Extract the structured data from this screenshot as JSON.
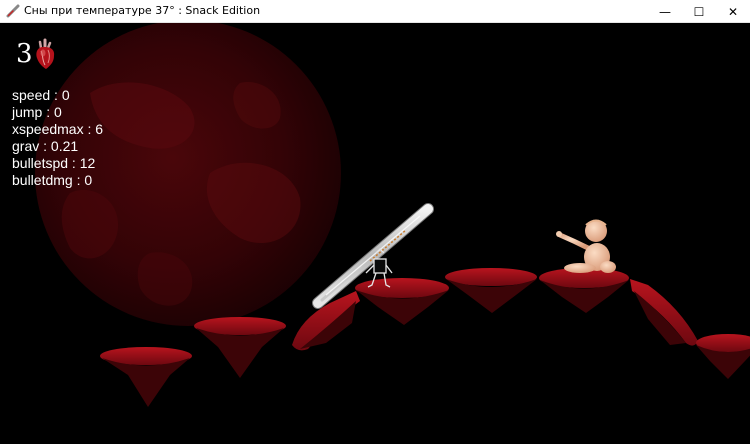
{
  "window": {
    "title": "Сны при температуре 37° : Snack Edition",
    "minimize_glyph": "—",
    "maximize_glyph": "☐",
    "close_glyph": "✕"
  },
  "hud": {
    "lives": "3",
    "stats": [
      "speed : 0",
      "jump : 0",
      "xspeedmax : 6",
      "grav : 0.21",
      "bulletspd : 12",
      "bulletdmg : 0"
    ]
  },
  "colors": {
    "planet": "#3a0306",
    "platform": "#8e0c14",
    "thermometer_glass": "#d8d8d8",
    "baby_skin": "#f0c4a4"
  },
  "icons": {
    "lives": "anatomical-heart-icon",
    "app": "thermometer-icon"
  }
}
